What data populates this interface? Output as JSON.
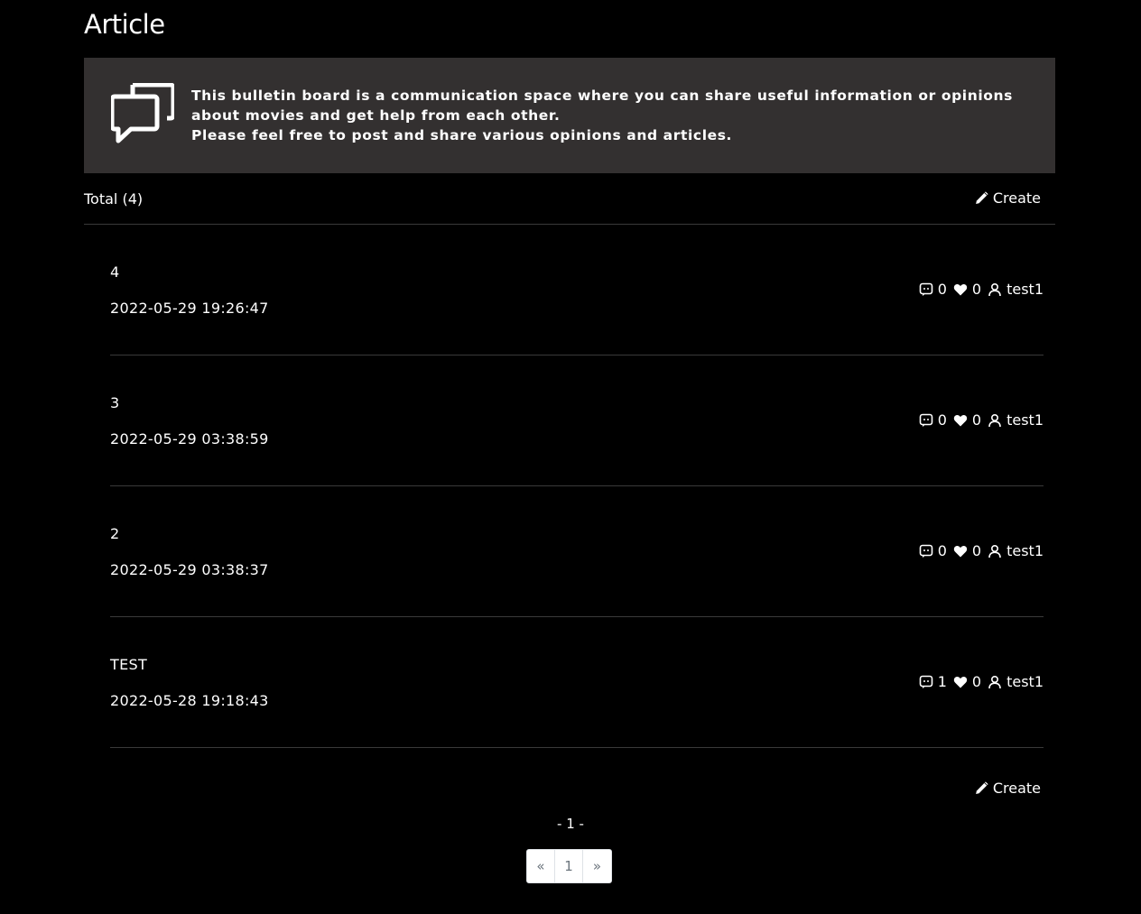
{
  "page": {
    "title": "Article"
  },
  "notice": {
    "icon": "chat-bubbles-icon",
    "line1": "This bulletin board is a communication space where you can share useful information or opinions about movies and get help from each other.",
    "line2": "Please feel free to post and share various opinions and articles."
  },
  "toolbar": {
    "total_label": "Total (4)",
    "create_label": "Create"
  },
  "articles": [
    {
      "title": "4",
      "date": "2022-05-29 19:26:47",
      "comments": "0",
      "likes": "0",
      "author": "test1"
    },
    {
      "title": "3",
      "date": "2022-05-29 03:38:59",
      "comments": "0",
      "likes": "0",
      "author": "test1"
    },
    {
      "title": "2",
      "date": "2022-05-29 03:38:37",
      "comments": "0",
      "likes": "0",
      "author": "test1"
    },
    {
      "title": "TEST",
      "date": "2022-05-28 19:18:43",
      "comments": "1",
      "likes": "0",
      "author": "test1"
    }
  ],
  "footer": {
    "create_label": "Create",
    "page_indicator": "- 1 -"
  },
  "pagination": {
    "prev": "«",
    "current": "1",
    "next": "»"
  },
  "colors": {
    "background": "#000000",
    "notice_background": "#333030",
    "divider": "#3a3a3a",
    "text": "#ffffff"
  }
}
